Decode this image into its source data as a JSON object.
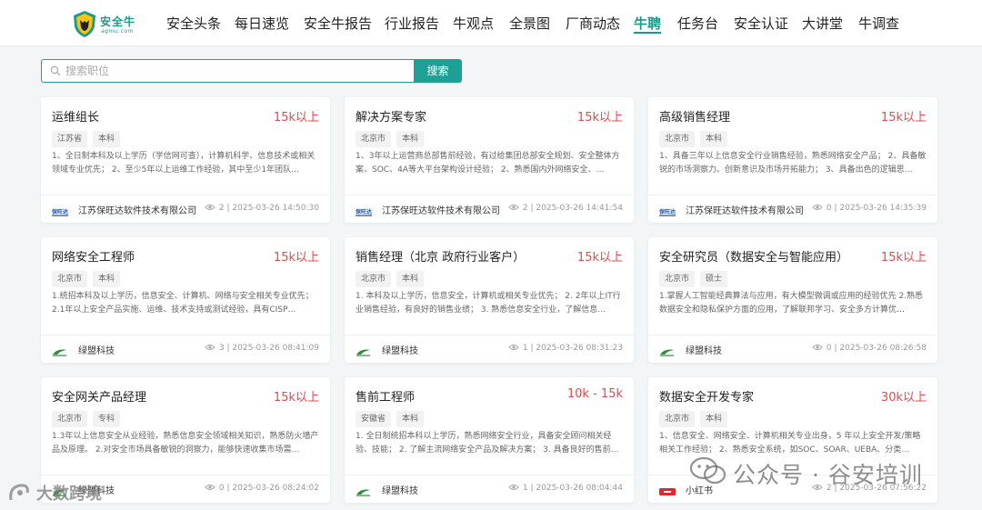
{
  "brand": {
    "name": "安全牛",
    "sub": "aqniu.com",
    "accent_color": "#1a9a8a"
  },
  "nav": {
    "items": [
      {
        "label": "安全头条"
      },
      {
        "label": "每日速览"
      },
      {
        "label": "安全牛报告"
      },
      {
        "label": "行业报告"
      },
      {
        "label": "牛观点"
      },
      {
        "label": "全景图"
      },
      {
        "label": "厂商动态"
      },
      {
        "label": "牛聘",
        "active": true
      },
      {
        "label": "任务台"
      },
      {
        "label": "安全认证"
      },
      {
        "label": "大讲堂"
      },
      {
        "label": "牛调查"
      }
    ]
  },
  "search": {
    "placeholder": "搜索职位",
    "value": "",
    "button_label": "搜索"
  },
  "jobs": [
    {
      "title": "运维组长",
      "salary": "15k以上",
      "tags": [
        "江苏省",
        "本科"
      ],
      "description": "1、全日制本科及以上学历（学信网可查），计算机科学、信息技术或相关领域专业优先； 2、至少5年以上运维工作经验，其中至少1年团队…",
      "company": "江苏保旺达软件技术有限公司",
      "company_logo": "baowangda-logo",
      "views": "2",
      "time": "2025-03-26 14:50:30"
    },
    {
      "title": "解决方案专家",
      "salary": "15k以上",
      "tags": [
        "北京市",
        "本科"
      ],
      "description": "1、3年以上运营商总部售前经验，有过给集团总部安全规划、安全整体方案、SOC、4A等大平台架构设计经验； 2、熟悉国内外网络安全、…",
      "company": "江苏保旺达软件技术有限公司",
      "company_logo": "baowangda-logo",
      "views": "2",
      "time": "2025-03-26 14:41:54"
    },
    {
      "title": "高级销售经理",
      "salary": "15k以上",
      "tags": [
        "北京市",
        "本科"
      ],
      "description": "1、具备三年以上信息安全行业销售经验，熟悉网络安全产品； 2、具备敏锐的市场洞察力、创新意识及市场开拓能力； 3、具备出色的逻辑思…",
      "company": "江苏保旺达软件技术有限公司",
      "company_logo": "baowangda-logo",
      "views": "0",
      "time": "2025-03-26 14:35:39"
    },
    {
      "title": "网络安全工程师",
      "salary": "15k以上",
      "tags": [
        "北京市",
        "本科"
      ],
      "description": "1.统招本科及以上学历，信息安全、计算机、网络与安全相关专业优先； 2.1年以上安全产品实施、运维、技术支持或测试经验，具有CISP…",
      "company": "绿盟科技",
      "company_logo": "nsfocus-logo",
      "views": "3",
      "time": "2025-03-26 08:41:09"
    },
    {
      "title": "销售经理（北京 政府行业客户）",
      "salary": "15k以上",
      "tags": [
        "北京市",
        "本科"
      ],
      "description": "1. 本科及以上学历，信息安全，计算机或相关专业优先； 2. 2年以上IT行业销售经验，有良好的销售业绩； 3. 熟悉信息安全行业，了解信息…",
      "company": "绿盟科技",
      "company_logo": "nsfocus-logo",
      "views": "1",
      "time": "2025-03-26 08:31:23"
    },
    {
      "title": "安全研究员（数据安全与智能应用）",
      "salary": "15k以上",
      "tags": [
        "北京市",
        "硕士"
      ],
      "description": "1.掌握人工智能经典算法与应用，有大模型微调或应用的经验优先 2.熟悉数据安全和隐私保护方面的应用，了解联邦学习、安全多方计算优…",
      "company": "绿盟科技",
      "company_logo": "nsfocus-logo",
      "views": "0",
      "time": "2025-03-26 08:26:58"
    },
    {
      "title": "安全网关产品经理",
      "salary": "15k以上",
      "tags": [
        "北京市",
        "专科"
      ],
      "description": "1.3年以上信息安全从业经验，熟悉信息安全领域相关知识，熟悉防火墙产品及原理。 2.对安全市场具备敏锐的洞察力，能够快速收集市场需…",
      "company": "绿盟科技",
      "company_logo": "nsfocus-logo",
      "views": "0",
      "time": "2025-03-26 08:24:02"
    },
    {
      "title": "售前工程师",
      "salary": "10k - 15k",
      "tags": [
        "安徽省",
        "本科"
      ],
      "description": "1. 全日制统招本科以上学历，熟悉网络安全行业，具备安全顾问相关经验、技能； 2. 了解主流网络安全产品及解决方案； 3. 具备良好的售前…",
      "company": "绿盟科技",
      "company_logo": "nsfocus-logo",
      "views": "1",
      "time": "2025-03-26 08:04:44"
    },
    {
      "title": "数据安全开发专家",
      "salary": "30k以上",
      "tags": [
        "北京市",
        "本科"
      ],
      "description": "1、信息安全、网络安全、计算机相关专业出身，5 年以上安全开发/策略相关工作经验； 2、熟悉安全系统，如SOC、SOAR、UEBA、分类…",
      "company": "小红书",
      "company_logo": "xiaohongshu-logo",
      "views": "2",
      "time": "2025-03-26 07:56:22"
    }
  ],
  "watermarks": {
    "left": "大数跨境",
    "right": "公众号 · 谷安培训"
  }
}
